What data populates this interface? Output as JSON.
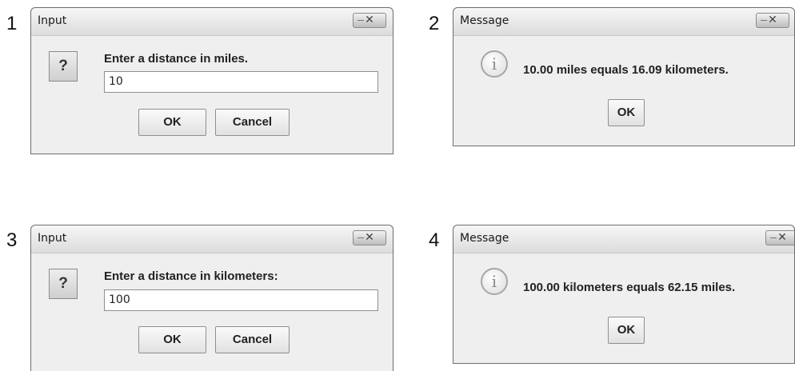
{
  "steps": [
    "1",
    "2",
    "3",
    "4"
  ],
  "dialogs": [
    {
      "title": "Input",
      "close_glyph": "✕",
      "icon": "question-icon",
      "icon_glyph": "?",
      "prompt": "Enter a distance in miles.",
      "input_value": "10",
      "ok_label": "OK",
      "cancel_label": "Cancel"
    },
    {
      "title": "Message",
      "close_glyph": "✕",
      "icon": "info-icon",
      "icon_glyph": "i",
      "message": "10.00 miles equals 16.09 kilometers.",
      "ok_label": "OK"
    },
    {
      "title": "Input",
      "close_glyph": "✕",
      "icon": "question-icon",
      "icon_glyph": "?",
      "prompt": "Enter a distance in kilometers:",
      "input_value": "100",
      "ok_label": "OK",
      "cancel_label": "Cancel"
    },
    {
      "title": "Message",
      "close_glyph": "✕",
      "icon": "info-icon",
      "icon_glyph": "i",
      "message": "100.00 kilometers equals 62.15 miles.",
      "ok_label": "OK"
    }
  ]
}
